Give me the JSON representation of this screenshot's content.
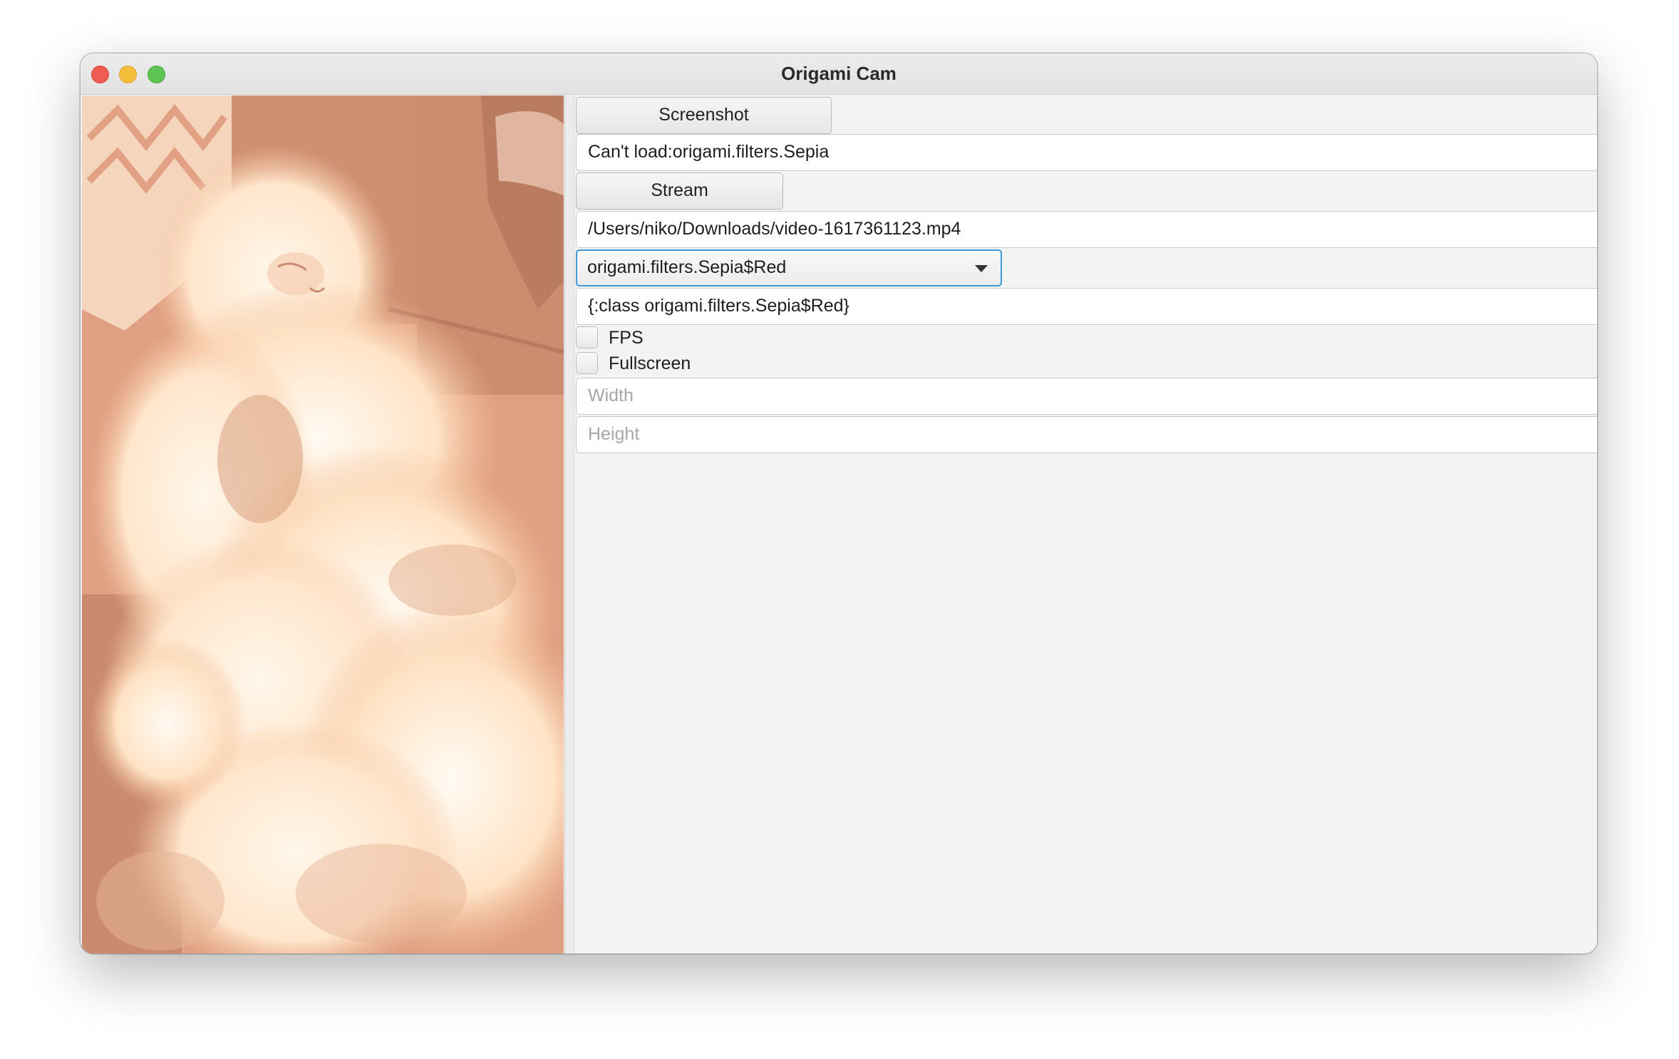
{
  "window": {
    "title": "Origami Cam"
  },
  "preview": {
    "description_icon": "camera-preview",
    "tint": "#ffd8bb"
  },
  "controls": {
    "screenshot_label": "Screenshot",
    "status_text": "Can't load:origami.filters.Sepia",
    "stream_label": "Stream",
    "stream_path": "/Users/niko/Downloads/video-1617361123.mp4",
    "filter_select": {
      "selected": "origami.filters.Sepia$Red"
    },
    "filter_options_text": "{:class origami.filters.Sepia$Red}",
    "fps_label": "FPS",
    "fps_checked": false,
    "fullscreen_label": "Fullscreen",
    "fullscreen_checked": false,
    "width_placeholder": "Width",
    "height_placeholder": "Height"
  },
  "colors": {
    "accent": "#3a9bd9",
    "close": "#ee5c52",
    "minimize": "#f5be3b",
    "zoom": "#5fc552"
  }
}
